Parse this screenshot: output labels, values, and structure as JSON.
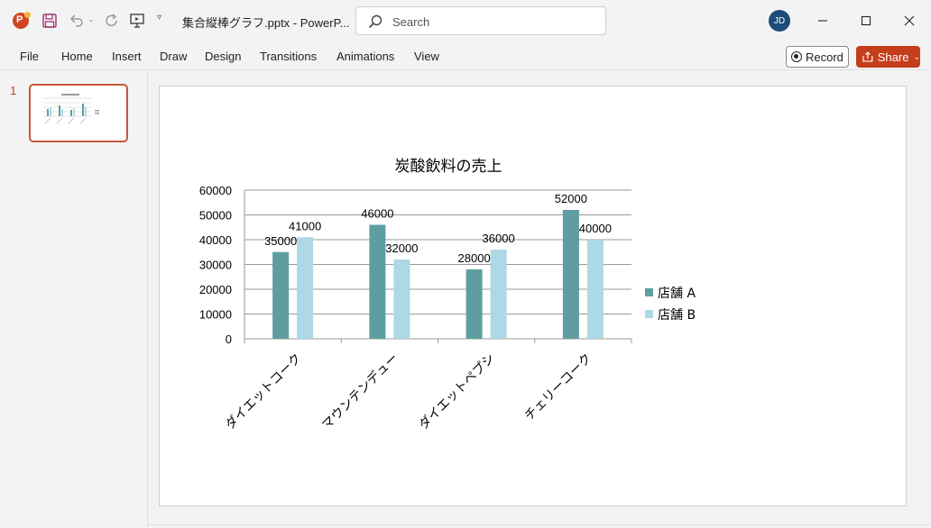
{
  "titlebar": {
    "doc_title": "集合縦棒グラフ.pptx  -  PowerP...",
    "search_placeholder": "Search",
    "user_initials": "JD"
  },
  "ribbon": {
    "tabs": [
      "File",
      "Home",
      "Insert",
      "Draw",
      "Design",
      "Transitions",
      "Animations",
      "View"
    ],
    "record_label": "Record",
    "share_label": "Share"
  },
  "thumbnails": {
    "slide_number": "1"
  },
  "colors": {
    "accent": "#c43e1c",
    "series_a": "#5f9ea0",
    "series_b": "#add8e6"
  },
  "chart_data": {
    "type": "bar",
    "title": "炭酸飲料の売上",
    "categories": [
      "ダイエットコーク",
      "マウンテンデュー",
      "ダイエットペプシ",
      "チェリーコーク"
    ],
    "series": [
      {
        "name": "店舗 A",
        "values": [
          35000,
          46000,
          28000,
          52000
        ],
        "color": "#5f9ea0"
      },
      {
        "name": "店舗 B",
        "values": [
          41000,
          32000,
          36000,
          40000
        ],
        "color": "#add8e6"
      }
    ],
    "yticks": [
      "0",
      "10000",
      "20000",
      "30000",
      "40000",
      "50000",
      "60000"
    ],
    "ylim": [
      0,
      60000
    ],
    "grid": true,
    "legend": "right"
  }
}
